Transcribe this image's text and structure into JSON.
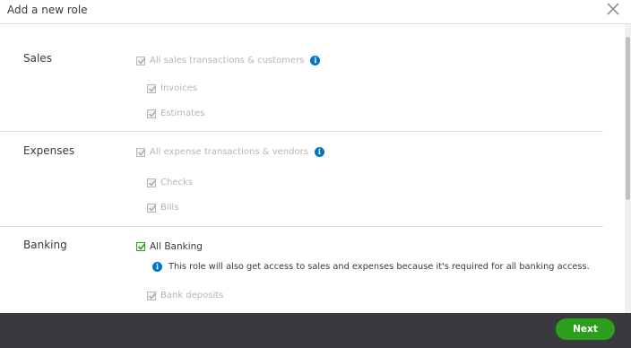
{
  "dialog": {
    "title": "Add a new role"
  },
  "sections": {
    "sales": {
      "label": "Sales",
      "all_label": "All sales transactions & customers",
      "items": [
        "Invoices",
        "Estimates"
      ]
    },
    "expenses": {
      "label": "Expenses",
      "all_label": "All expense transactions & vendors",
      "items": [
        "Checks",
        "Bills"
      ]
    },
    "banking": {
      "label": "Banking",
      "all_label": "All Banking",
      "note": "This role will also get access to sales and expenses because it's required for all banking access.",
      "items": [
        "Bank deposits"
      ]
    }
  },
  "footer": {
    "next_label": "Next"
  },
  "icons": {
    "close": "close-icon",
    "info": "info-icon",
    "check": "checkmark-icon"
  },
  "colors": {
    "accent": "#2ca01c",
    "info": "#0077c5",
    "footer": "#393a3d"
  }
}
